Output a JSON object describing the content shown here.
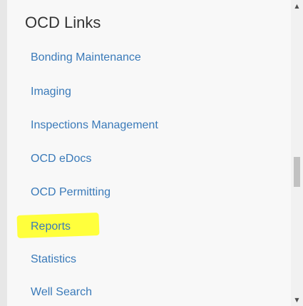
{
  "panel": {
    "title": "OCD Links",
    "links": [
      {
        "label": "Bonding Maintenance"
      },
      {
        "label": "Imaging"
      },
      {
        "label": "Inspections Management"
      },
      {
        "label": "OCD eDocs"
      },
      {
        "label": "OCD Permitting"
      },
      {
        "label": "Reports"
      },
      {
        "label": "Statistics"
      },
      {
        "label": "Well Search"
      }
    ]
  },
  "scrollbar": {
    "up_icon": "triangle-up-icon",
    "down_icon": "triangle-down-icon"
  },
  "colors": {
    "link": "#3a7ab9",
    "title": "#333333",
    "highlight": "#ffff3c",
    "panel_bg": "#f8f8f8"
  }
}
